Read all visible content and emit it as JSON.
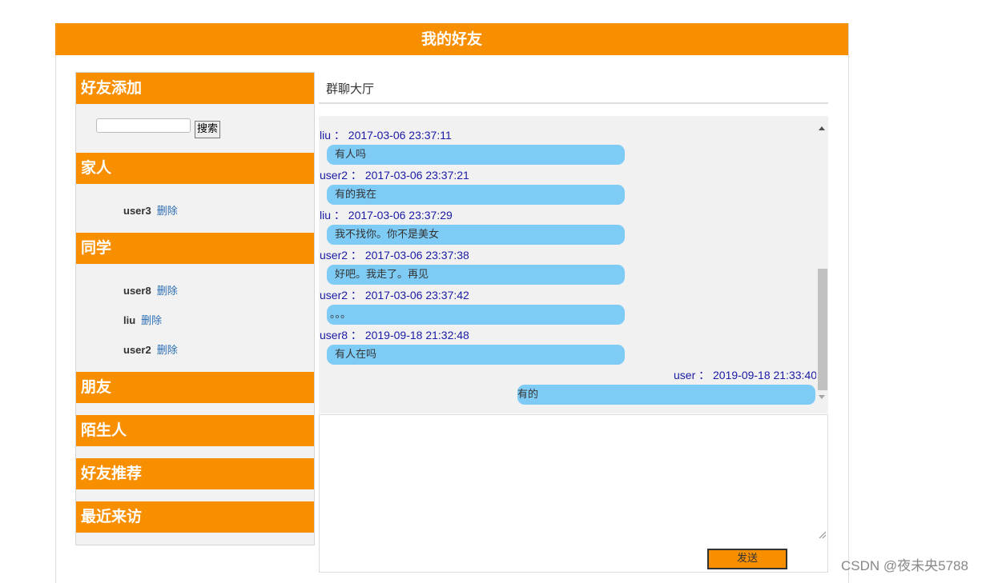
{
  "header": {
    "title": "我的好友"
  },
  "sidebar": {
    "sections": [
      {
        "title": "好友添加"
      },
      {
        "title": "家人"
      },
      {
        "title": "同学"
      },
      {
        "title": "朋友"
      },
      {
        "title": "陌生人"
      },
      {
        "title": "好友推荐"
      },
      {
        "title": "最近来访"
      }
    ],
    "search": {
      "button_label": "搜索",
      "value": ""
    },
    "family": [
      {
        "name": "user3",
        "delete_label": "删除"
      }
    ],
    "classmates": [
      {
        "name": "user8",
        "delete_label": "删除"
      },
      {
        "name": "liu",
        "delete_label": "删除"
      },
      {
        "name": "user2",
        "delete_label": "删除"
      }
    ]
  },
  "chat": {
    "room_title": "群聊大厅",
    "messages": [
      {
        "sender": "liu",
        "separator": "：",
        "time": "2017-03-06 23:37:11",
        "text": "有人吗",
        "side": "left"
      },
      {
        "sender": "user2",
        "separator": "：",
        "time": "2017-03-06 23:37:21",
        "text": "有的我在",
        "side": "left"
      },
      {
        "sender": "liu",
        "separator": "：",
        "time": "2017-03-06 23:37:29",
        "text": "我不找你。你不是美女",
        "side": "left"
      },
      {
        "sender": "user2",
        "separator": "：",
        "time": "2017-03-06 23:37:38",
        "text": "好吧。我走了。再见",
        "side": "left"
      },
      {
        "sender": "user2",
        "separator": "：",
        "time": "2017-03-06 23:37:42",
        "text": "。。。",
        "side": "left"
      },
      {
        "sender": "user8",
        "separator": "：",
        "time": "2019-09-18 21:32:48",
        "text": "有人在吗",
        "side": "left"
      },
      {
        "sender": "user",
        "separator": "：",
        "time": "2019-09-18 21:33:40",
        "text": "有的",
        "side": "right"
      }
    ],
    "composer_value": "",
    "send_label": "发送"
  },
  "watermark": "CSDN @夜未央5788",
  "colors": {
    "accent": "#f78f00",
    "bubble": "#7ecbf5",
    "meta_text": "#1a1aa6",
    "link": "#2a6db5"
  }
}
